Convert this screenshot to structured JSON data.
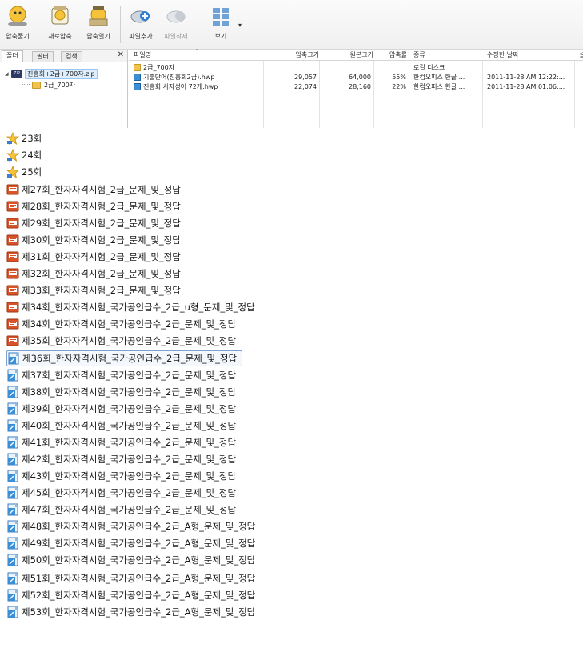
{
  "toolbar": {
    "buttons": [
      {
        "label": "압축풀기",
        "icon": "extract-icon",
        "enabled": true
      },
      {
        "label": "새로압축",
        "icon": "new-archive-icon",
        "enabled": true
      },
      {
        "label": "압축열기",
        "icon": "open-archive-icon",
        "enabled": true
      },
      {
        "label": "파일추가",
        "icon": "add-file-icon",
        "enabled": true
      },
      {
        "label": "파일삭제",
        "icon": "delete-file-icon",
        "enabled": false
      },
      {
        "label": "보기",
        "icon": "view-icon",
        "enabled": true
      }
    ]
  },
  "left_pane": {
    "tabs": [
      "폴더",
      "필터",
      "검색"
    ],
    "active_tab": "폴더",
    "close_glyph": "✕",
    "tree": {
      "root": "진흥회+2급+700자.zip",
      "child": "2급_700자"
    }
  },
  "file_list": {
    "columns": [
      "파일명",
      "압축크기",
      "원본크기",
      "압축률",
      "종류",
      "수정한 날짜",
      "설"
    ],
    "rows": [
      {
        "icon": "folder-icon",
        "name": "2급_700자",
        "packed": "",
        "original": "",
        "ratio": "",
        "type": "로컬 디스크",
        "date": ""
      },
      {
        "icon": "hwp-icon",
        "name": "기출단어(진흥회2급).hwp",
        "packed": "29,057",
        "original": "64,000",
        "ratio": "55%",
        "type": "한컴오피스 한글 ...",
        "date": "2011-11-28 AM 12:22:..."
      },
      {
        "icon": "hwp-icon",
        "name": "진흥회 사자성어 72개.hwp",
        "packed": "22,074",
        "original": "28,160",
        "ratio": "22%",
        "type": "한컴오피스 한글 ...",
        "date": "2011-11-28 AM 01:06:..."
      }
    ]
  },
  "explorer_items": [
    {
      "icon": "star-icon",
      "label": "23회"
    },
    {
      "icon": "star-icon",
      "label": "24회"
    },
    {
      "icon": "star-icon",
      "label": "25회"
    },
    {
      "icon": "book-icon",
      "label": "제27회_한자자격시험_2급_문제_및_정답"
    },
    {
      "icon": "book-icon",
      "label": "제28회_한자자격시험_2급_문제_및_정답"
    },
    {
      "icon": "book-icon",
      "label": "제29회_한자자격시험_2급_문제_및_정답"
    },
    {
      "icon": "book-icon",
      "label": "제30회_한자자격시험_2급_문제_및_정답"
    },
    {
      "icon": "book-icon",
      "label": "제31회_한자자격시험_2급_문제_및_정답"
    },
    {
      "icon": "book-icon",
      "label": "제32회_한자자격시험_2급_문제_및_정답"
    },
    {
      "icon": "book-icon",
      "label": "제33회_한자자격시험_2급_문제_및_정답"
    },
    {
      "icon": "book-icon",
      "label": "제34회_한자자격시험_국가공인급수_2급_u형_문제_및_정답"
    },
    {
      "icon": "book-icon",
      "label": "제34회_한자자격시험_국가공인급수_2급_문제_및_정답"
    },
    {
      "icon": "book-icon",
      "label": "제35회_한자자격시험_국가공인급수_2급_문제_및_정답"
    },
    {
      "icon": "hwp-doc-icon",
      "label": "제36회_한자자격시험_국가공인급수_2급_문제_및_정답",
      "selected": true
    },
    {
      "icon": "hwp-doc-icon",
      "label": "제37회_한자자격시험_국가공인급수_2급_문제_및_정답"
    },
    {
      "icon": "hwp-doc-icon",
      "label": "제38회_한자자격시험_국가공인급수_2급_문제_및_정답"
    },
    {
      "icon": "hwp-doc-icon",
      "label": "제39회_한자자격시험_국가공인급수_2급_문제_및_정답"
    },
    {
      "icon": "hwp-doc-icon",
      "label": "제40회_한자자격시험_국가공인급수_2급_문제_및_정답"
    },
    {
      "icon": "hwp-doc-icon",
      "label": "제41회_한자자격시험_국가공인급수_2급_문제_및_정답"
    },
    {
      "icon": "hwp-doc-icon",
      "label": "제42회_한자자격시험_국가공인급수_2급_문제_및_정답"
    },
    {
      "icon": "hwp-doc-icon",
      "label": "제43회_한자자격시험_국가공인급수_2급_문제_및_정답"
    },
    {
      "icon": "hwp-doc-icon",
      "label": "제45회_한자자격시험_국가공인급수_2급_문제_및_정답"
    },
    {
      "icon": "hwp-doc-icon",
      "label": "제47회_한자자격시험_국가공인급수_2급_문제_및_정답"
    },
    {
      "icon": "hwp-doc-icon",
      "label": "제48회_한자자격시험_국가공인급수_2급_A형_문제_및_정답"
    },
    {
      "icon": "hwp-doc-icon",
      "label": "제49회_한자자격시험_국가공인급수_2급_A형_문제_및_정답"
    },
    {
      "icon": "hwp-doc-icon",
      "label": "제50회_한자자격시험_국가공인급수_2급_A형_문제_및_정답"
    },
    {
      "icon": "hwp-doc-icon",
      "label": "제51회_한자자격시험_국가공인급수_2급_A형_문제_및_정답"
    },
    {
      "icon": "hwp-doc-icon",
      "label": "제52회_한자자격시험_국가공인급수_2급_A형_문제_및_정답"
    },
    {
      "icon": "hwp-doc-icon",
      "label": "제53회_한자자격시험_국가공인급수_2급_A형_문제_및_정답"
    }
  ],
  "colors": {
    "selection_border": "#7da2ce",
    "zip_badge": "#2d3a63",
    "folder": "#f2c24e",
    "hwp": "#3a8fd6",
    "book": "#d9532a"
  }
}
